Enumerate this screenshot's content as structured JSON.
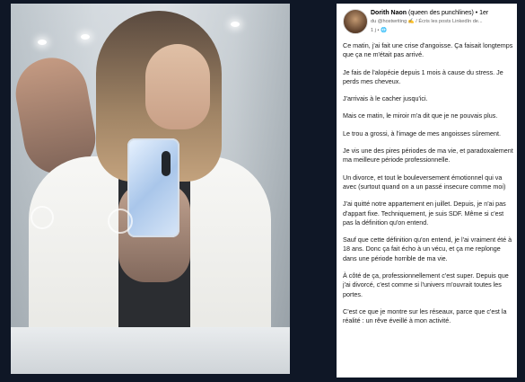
{
  "post": {
    "author_name": "Dorith Naon",
    "author_tagline": "(queen des punchlines)",
    "time_ago": "• 1er",
    "hashtag_line": "du @hostwriting ✍️ / Écris les posts LinkedIn de...",
    "visibility": "1 j • 🌐",
    "paragraphs": [
      "Ce matin, j'ai fait une crise d'angoisse. Ça faisait longtemps que ça ne m'était pas arrivé.",
      "Je fais de l'alopécie depuis 1 mois à cause du stress. Je perds mes cheveux.",
      "J'arrivais à le cacher jusqu'ici.",
      "Mais ce matin, le miroir m'a dit que je ne pouvais plus.",
      "Le trou a grossi, à l'image de mes angoisses sûrement.",
      "Je vis une des pires périodes de ma vie, et paradoxalement ma meilleure période professionnelle.",
      "Un divorce, et tout le bouleversement émotionnel qui va avec (surtout quand on a un passé insecure comme moi)",
      "J'ai quitté notre appartement en juillet. Depuis, je n'ai pas d'appart fixe. Techniquement, je suis SDF. Même si c'est pas la définition qu'on entend.",
      "Sauf que cette définition qu'on entend, je l'ai vraiment été à 18 ans. Donc ça fait écho à un vécu, et ça me replonge dans une période horrible de ma vie.",
      "À côté de ça, professionnellement c'est super. Depuis que j'ai divorcé, c'est comme si l'univers m'ouvrait toutes les portes.",
      "C'est ce que je montre sur les réseaux, parce que c'est la réalité : un rêve éveillé à mon activité."
    ]
  }
}
